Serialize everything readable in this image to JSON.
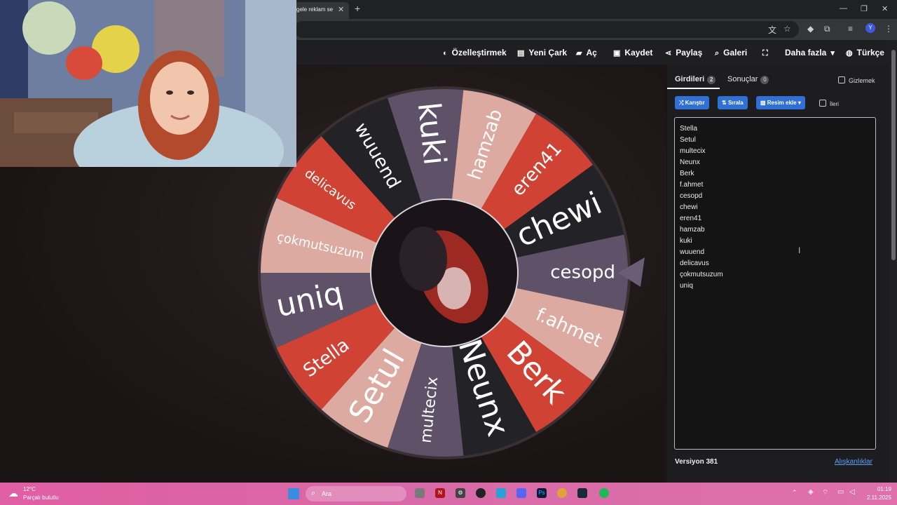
{
  "browser": {
    "tab_title": "gele reklam seç",
    "tab_close": "✕",
    "new_tab": "+",
    "window_controls": [
      "—",
      "❐",
      "✕"
    ],
    "profile_initial": "Y"
  },
  "nav": {
    "items": [
      {
        "icon": "palette-icon",
        "glyph": "◐",
        "label": "Özelleştirmek"
      },
      {
        "icon": "file-icon",
        "glyph": "▤",
        "label": "Yeni Çark"
      },
      {
        "icon": "folder-open-icon",
        "glyph": "▰",
        "label": "Aç"
      },
      {
        "icon": "save-icon",
        "glyph": "▣",
        "label": "Kaydet"
      },
      {
        "icon": "share-icon",
        "glyph": "⋖",
        "label": "Paylaş"
      },
      {
        "icon": "search-icon",
        "glyph": "⌕",
        "label": "Galeri"
      },
      {
        "icon": "fullscreen-icon",
        "glyph": "⛶",
        "label": ""
      },
      {
        "icon": "caret-down-icon",
        "glyph": "▾",
        "label": "Daha fazla"
      },
      {
        "icon": "globe-icon",
        "glyph": "◍",
        "label": "Türkçe"
      }
    ]
  },
  "wheel": {
    "segments": [
      {
        "label": "cesopd",
        "color": "#5f5268"
      },
      {
        "label": "f.ahmet",
        "color": "#ddaaa2"
      },
      {
        "label": "Berk",
        "color": "#cf4234"
      },
      {
        "label": "Neunx",
        "color": "#232226"
      },
      {
        "label": "multecix",
        "color": "#5f5268"
      },
      {
        "label": "Setul",
        "color": "#ddaaa2"
      },
      {
        "label": "Stella",
        "color": "#cf4234"
      },
      {
        "label": "uniq",
        "color": "#5f5268"
      },
      {
        "label": "çokmutsuzum",
        "color": "#ddaaa2"
      },
      {
        "label": "delicavus",
        "color": "#cf4234"
      },
      {
        "label": "wuuend",
        "color": "#232226"
      },
      {
        "label": "kuki",
        "color": "#5f5268"
      },
      {
        "label": "hamzab",
        "color": "#ddaaa2"
      },
      {
        "label": "eren41",
        "color": "#cf4234"
      },
      {
        "label": "chewi",
        "color": "#232226"
      }
    ],
    "pointer_color": "#6b5d78",
    "rim_color": "#3a3034"
  },
  "panel": {
    "tabs": [
      {
        "label": "Girdileri",
        "count": "2"
      },
      {
        "label": "Sonuçlar",
        "count": "0"
      }
    ],
    "hide_label": "Gizlemek",
    "buttons": {
      "shuffle": "Karıştır",
      "sort": "Sırala",
      "add_image": "Resim ekle"
    },
    "advanced_label": "İleri",
    "entries": [
      "Stella",
      "Setul",
      "multecix",
      "Neunx",
      "Berk",
      "f.ahmet",
      "cesopd",
      "chewi",
      "eren41",
      "hamzab",
      "kuki",
      "wuuend",
      "delicavus",
      "çokmutsuzum",
      "uniq"
    ],
    "version": "Versiyon 381",
    "shortcuts_link": "Alışkanlıklar",
    "accent_color": "#2f6fd6"
  },
  "taskbar": {
    "weather_temp": "12°C",
    "weather_desc": "Parçalı bulutlu",
    "search_placeholder": "Ara",
    "time": "01:19",
    "date": "2.11.2025"
  }
}
